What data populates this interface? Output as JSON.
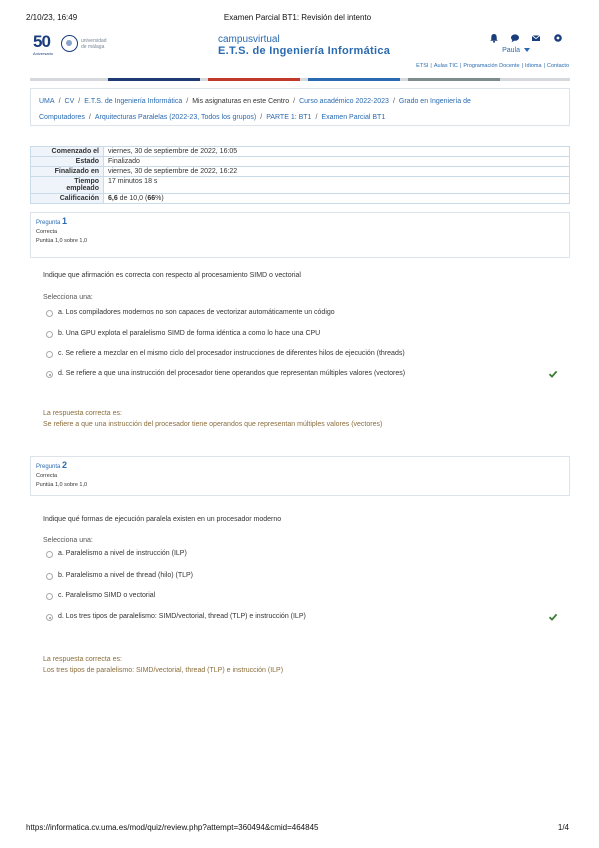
{
  "print_header": {
    "datetime": "2/10/23, 16:49",
    "title": "Examen Parcial BT1: Revisión del intento"
  },
  "print_footer": {
    "url": "https://informatica.cv.uma.es/mod/quiz/review.php?attempt=360494&cmid=464845",
    "page": "1/4"
  },
  "brand": {
    "anniversary_number": "50",
    "anniversary_sub": "Aniversario",
    "university_lines": [
      "universidad",
      "de málaga"
    ],
    "title_line1": "campusvirtual",
    "title_line2": "E.T.S. de Ingeniería Informática",
    "user_name": "Paula"
  },
  "top_icons": [
    "bell-icon",
    "chat-icon",
    "mail-icon",
    "settings-icon"
  ],
  "colors": {
    "accent": "#2a6ab0",
    "navy": "#1a3d7c",
    "correct": "#3a7d34",
    "feedback": "#8a6d3b"
  },
  "color_segments": [
    "#1f3b73",
    "#c0392b",
    "#2a6ab0",
    "#7f8c8d"
  ],
  "links": [
    "ETSI",
    "Aulas TIC",
    "Programación Docente",
    "Idioma",
    "Contacto"
  ],
  "breadcrumb": [
    {
      "label": "UMA",
      "current": false
    },
    {
      "label": "CV",
      "current": false
    },
    {
      "label": "E.T.S. de Ingeniería Informática",
      "current": false
    },
    {
      "label": "Mis asignaturas en este Centro",
      "current": true
    },
    {
      "label": "Curso académico 2022-2023",
      "current": false
    },
    {
      "label": "Grado en Ingeniería de Computadores",
      "current": false
    },
    {
      "label": "Arquitecturas Paralelas (2022-23, Todos los grupos)",
      "current": false
    },
    {
      "label": "PARTE 1: BT1",
      "current": false
    },
    {
      "label": "Examen Parcial BT1",
      "current": false
    }
  ],
  "summary": {
    "started_label": "Comenzado el",
    "started_value": "viernes, 30 de septiembre de 2022, 16:05",
    "state_label": "Estado",
    "state_value": "Finalizado",
    "finished_label": "Finalizado en",
    "finished_value": "viernes, 30 de septiembre de 2022, 16:22",
    "time_label_1": "Tiempo",
    "time_label_2": "empleado",
    "time_value": "17 minutos 18 s",
    "grade_label": "Calificación",
    "grade_bold_1": "6,6",
    "grade_mid": " de 10,0 (",
    "grade_bold_2": "66",
    "grade_end": "%)"
  },
  "questions": [
    {
      "label": "Pregunta",
      "number": "1",
      "status": "Correcta",
      "points": "Puntúa 1,0 sobre 1,0",
      "text": "Indique que afirmación es correcta con respecto al procesamiento SIMD o vectorial",
      "prompt": "Selecciona una:",
      "options": [
        {
          "text": "a. Los compiladores modernos no son capaces de vectorizar automáticamente un código",
          "selected": false
        },
        {
          "text": "b. Una GPU explota el paralelismo SIMD de forma idéntica a como lo hace una CPU",
          "selected": false
        },
        {
          "text": "c. Se refiere a mezclar en el mismo ciclo del procesador instrucciones de diferentes hilos de ejecución (threads)",
          "selected": false
        },
        {
          "text": "d. Se refiere a que una instrucción del procesador tiene operandos que representan múltiples valores (vectores)",
          "selected": true
        }
      ],
      "feedback_title": "La respuesta correcta es:",
      "feedback_answer": "Se refiere a que una instrucción del procesador tiene operandos que representan múltiples valores (vectores)"
    },
    {
      "label": "Pregunta",
      "number": "2",
      "status": "Correcta",
      "points": "Puntúa 1,0 sobre 1,0",
      "text": "Indique qué formas de ejecución paralela existen en un procesador moderno",
      "prompt": "Selecciona una:",
      "options": [
        {
          "text": "a. Paralelismo a nivel de instrucción (ILP)",
          "selected": false
        },
        {
          "text": "b. Paralelismo a nivel de thread (hilo) (TLP)",
          "selected": false
        },
        {
          "text": "c. Paralelismo SIMD o vectorial",
          "selected": false
        },
        {
          "text": "d. Los tres tipos de paralelismo: SIMD/vectorial, thread (TLP) e instrucción (ILP)",
          "selected": true
        }
      ],
      "feedback_title": "La respuesta correcta es:",
      "feedback_answer": "Los tres tipos de paralelismo: SIMD/vectorial, thread (TLP) e instrucción (ILP)"
    }
  ]
}
